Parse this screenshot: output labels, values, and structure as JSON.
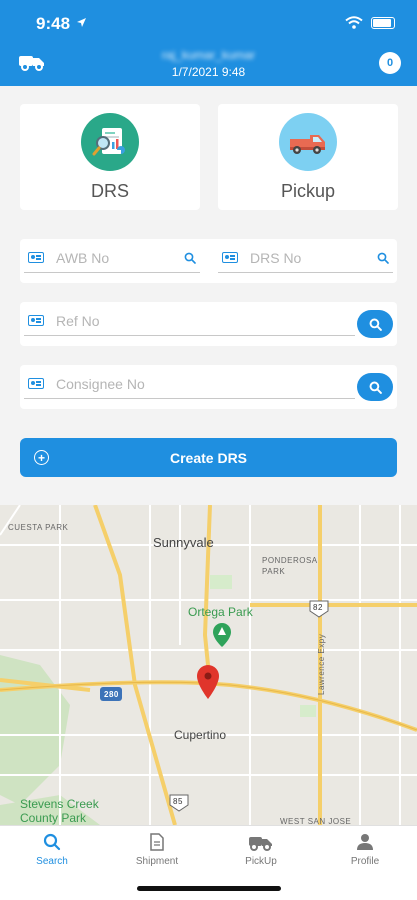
{
  "status": {
    "time": "9:48"
  },
  "header": {
    "user_name": "raj_kumar_kumar",
    "datetime": "1/7/2021 9:48",
    "badge": "0"
  },
  "cards": [
    {
      "label": "DRS"
    },
    {
      "label": "Pickup"
    }
  ],
  "fields": {
    "awb": {
      "placeholder": "AWB No"
    },
    "drs": {
      "placeholder": "DRS No"
    },
    "ref": {
      "placeholder": "Ref No"
    },
    "consignee": {
      "placeholder": "Consignee No"
    }
  },
  "create_button": {
    "label": "Create DRS"
  },
  "map": {
    "city_main": "Sunnyvale",
    "city_second": "Cupertino",
    "park_green": "Ortega Park",
    "park_creek": "Stevens Creek County Park",
    "area_cuesta": "CUESTA PARK",
    "area_ponderosa": "PONDEROSA PARK",
    "area_west": "WEST SAN JOSE",
    "road_lawrence": "Lawrence Expy",
    "shield_280": "280",
    "shield_82": "82",
    "shield_85": "85"
  },
  "tabs": [
    {
      "label": "Search"
    },
    {
      "label": "Shipment"
    },
    {
      "label": "PickUp"
    },
    {
      "label": "Profile"
    }
  ],
  "colors": {
    "primary": "#1f8fe0",
    "background": "#f3f3f3",
    "pin": "#e0352b"
  }
}
